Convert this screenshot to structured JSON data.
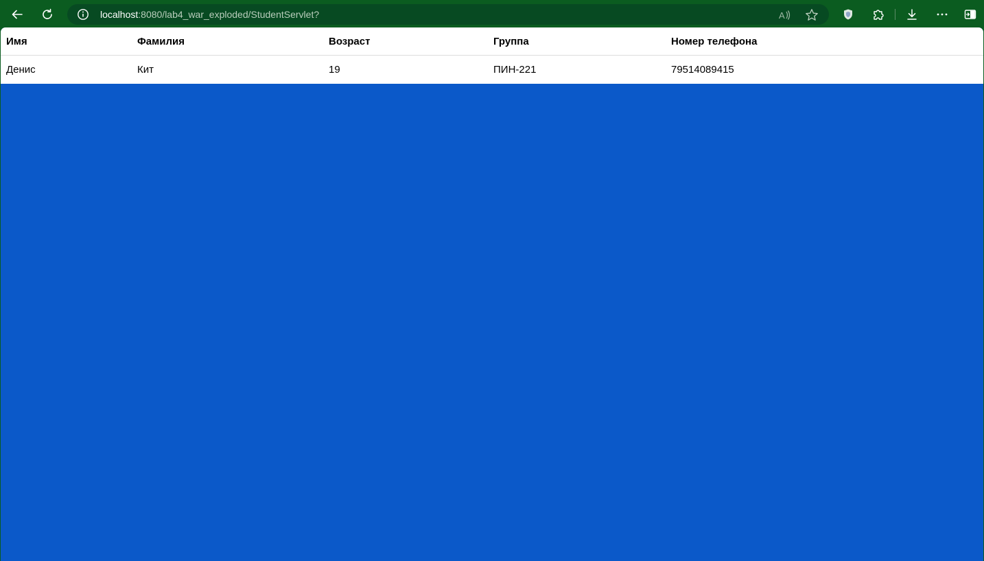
{
  "browser": {
    "url_host": "localhost",
    "url_rest": ":8080/lab4_war_exploded/StudentServlet?",
    "icons": {
      "back": "back-arrow-icon",
      "reload": "reload-icon",
      "info": "info-icon",
      "read_aloud": "read-aloud-icon",
      "favorite": "star-icon",
      "browser_essentials": "shield-icon",
      "extensions": "puzzle-icon",
      "downloads": "download-icon",
      "menu": "more-icon",
      "split": "split-screen-icon"
    },
    "colors": {
      "toolbar": "#0b5c20",
      "address_bar": "#074a22"
    }
  },
  "page": {
    "background": "#0b59c9",
    "table": {
      "columns": [
        "Имя",
        "Фамилия",
        "Возраст",
        "Группа",
        "Номер телефона"
      ],
      "rows": [
        [
          "Денис",
          "Кит",
          "19",
          "ПИН-221",
          "79514089415"
        ]
      ]
    }
  }
}
